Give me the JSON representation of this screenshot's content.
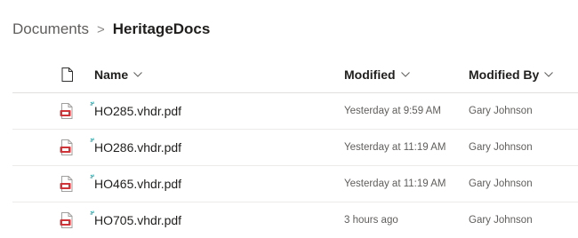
{
  "breadcrumb": {
    "parent": "Documents",
    "separator": ">",
    "current": "HeritageDocs"
  },
  "columns": {
    "name": "Name",
    "modified": "Modified",
    "modified_by": "Modified By"
  },
  "icons": {
    "header_file": "file-icon",
    "row_file": "pdf-file-icon",
    "new_marker": "new-item-sparkle-icon",
    "sort": "chevron-down-icon"
  },
  "colors": {
    "pdf_red": "#d13438",
    "new_marker": "#0f9ca0"
  },
  "files": [
    {
      "name": "HO285.vhdr.pdf",
      "modified": "Yesterday at 9:59 AM",
      "modified_by": "Gary Johnson"
    },
    {
      "name": "HO286.vhdr.pdf",
      "modified": "Yesterday at 11:19 AM",
      "modified_by": "Gary Johnson"
    },
    {
      "name": "HO465.vhdr.pdf",
      "modified": "Yesterday at 11:19 AM",
      "modified_by": "Gary Johnson"
    },
    {
      "name": "HO705.vhdr.pdf",
      "modified": "3 hours ago",
      "modified_by": "Gary Johnson"
    }
  ]
}
